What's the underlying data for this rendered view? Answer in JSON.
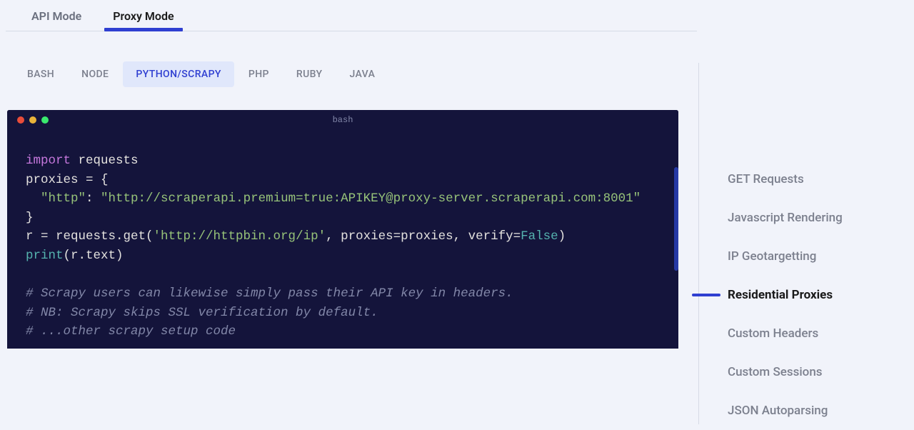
{
  "mode_tabs": [
    {
      "label": "API Mode",
      "active": false
    },
    {
      "label": "Proxy Mode",
      "active": true
    }
  ],
  "lang_tabs": [
    {
      "label": "BASH",
      "active": false
    },
    {
      "label": "NODE",
      "active": false
    },
    {
      "label": "PYTHON/SCRAPY",
      "active": true
    },
    {
      "label": "PHP",
      "active": false
    },
    {
      "label": "RUBY",
      "active": false
    },
    {
      "label": "JAVA",
      "active": false
    }
  ],
  "terminal": {
    "title": "bash",
    "lines": {
      "l0a": "import ",
      "l0b": "requests",
      "l1": "proxies = {",
      "l2a": "  \"http\"",
      "l2b": ": ",
      "l2c": "\"http://scraperapi.premium=true:APIKEY@proxy-server.scraperapi.com:8001\"",
      "l3": "}",
      "l4a": "r = requests.get(",
      "l4b": "'http://httpbin.org/ip'",
      "l4c": ", proxies=proxies, verify=",
      "l4d": "False",
      "l4e": ")",
      "l5a": "print",
      "l5b": "(r.text)",
      "l6": "",
      "l7": "# Scrapy users can likewise simply pass their API key in headers.",
      "l8": "# NB: Scrapy skips SSL verification by default.",
      "l9": "# ...other scrapy setup code"
    }
  },
  "sidenav": [
    {
      "label": "GET Requests",
      "active": false
    },
    {
      "label": "Javascript Rendering",
      "active": false
    },
    {
      "label": "IP Geotargetting",
      "active": false
    },
    {
      "label": "Residential Proxies",
      "active": true
    },
    {
      "label": "Custom Headers",
      "active": false
    },
    {
      "label": "Custom Sessions",
      "active": false
    },
    {
      "label": "JSON Autoparsing",
      "active": false
    }
  ]
}
